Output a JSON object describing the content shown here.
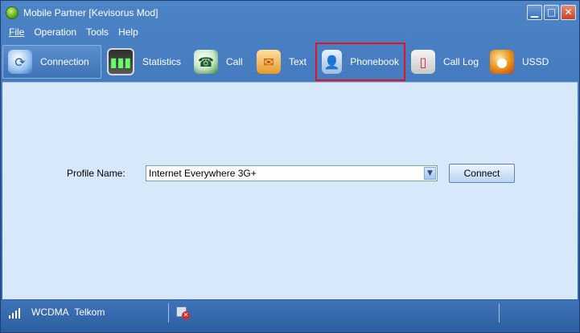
{
  "window": {
    "title": "Mobile Partner [Kevisorus Mod]",
    "buttons": {
      "minimize": "▁",
      "maximize": "□",
      "close": "✕"
    }
  },
  "menu": [
    "File",
    "Operation",
    "Tools",
    "Help"
  ],
  "toolbar": [
    {
      "label": "Connection",
      "icon": "connection-icon",
      "glyph": "⟳",
      "active": true
    },
    {
      "label": "Statistics",
      "icon": "statistics-icon",
      "glyph": "▮▮▮"
    },
    {
      "label": "Call",
      "icon": "call-icon",
      "glyph": "☎"
    },
    {
      "label": "Text",
      "icon": "text-icon",
      "glyph": "✉"
    },
    {
      "label": "Phonebook",
      "icon": "phonebook-icon",
      "glyph": "👤",
      "highlighted": true
    },
    {
      "label": "Call Log",
      "icon": "call-log-icon",
      "glyph": "▯"
    },
    {
      "label": "USSD",
      "icon": "ussd-icon",
      "glyph": "●"
    }
  ],
  "profile": {
    "label": "Profile Name:",
    "value": "Internet Everywhere 3G+",
    "dropdown_glyph": "▼"
  },
  "connect_button": "Connect",
  "status": {
    "network_type": "WCDMA",
    "operator": "Telkom"
  },
  "colors": {
    "highlight": "#e0151f",
    "content_bg": "#d6e8fa",
    "frame": "#2e62a8"
  }
}
